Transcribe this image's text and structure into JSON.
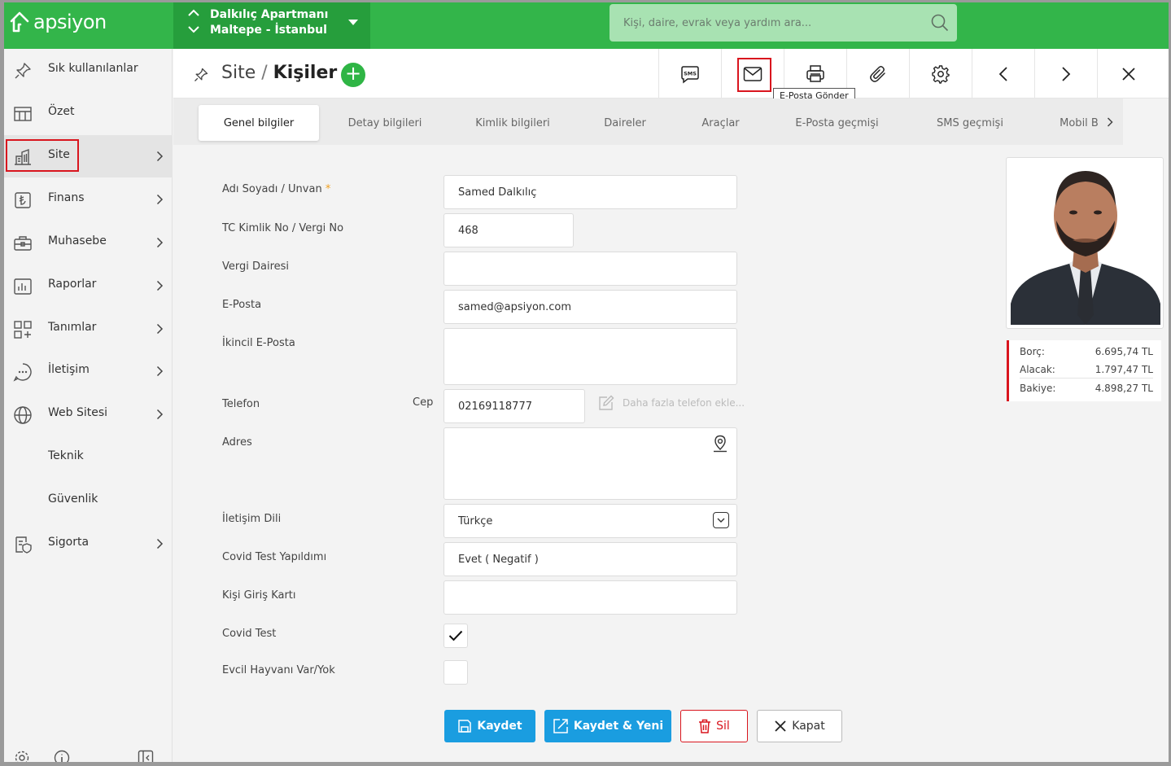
{
  "app": {
    "brand": "apsiyon"
  },
  "site_selector": {
    "name": "Dalkılıç Apartmanı",
    "location": "Maltepe - İstanbul"
  },
  "search": {
    "placeholder": "Kişi, daire, evrak veya yardım ara..."
  },
  "sidebar": {
    "items": [
      {
        "label": "Sık kullanılanlar",
        "icon": "pin-icon"
      },
      {
        "label": "Özet",
        "icon": "table-icon"
      },
      {
        "label": "Site",
        "icon": "building-icon"
      },
      {
        "label": "Finans",
        "icon": "lira-icon"
      },
      {
        "label": "Muhasebe",
        "icon": "briefcase-icon"
      },
      {
        "label": "Raporlar",
        "icon": "report-icon"
      },
      {
        "label": "Tanımlar",
        "icon": "grid-plus-icon"
      },
      {
        "label": "İletişim",
        "icon": "chat-icon"
      },
      {
        "label": "Web Sitesi",
        "icon": "globe-icon"
      },
      {
        "label": "Teknik",
        "icon": ""
      },
      {
        "label": "Güvenlik",
        "icon": ""
      },
      {
        "label": "Sigorta",
        "icon": "shield-doc-icon"
      }
    ]
  },
  "header": {
    "section": "Site",
    "separator": "/",
    "page": "Kişiler"
  },
  "toolbar": {
    "tooltip": "E-Posta Gönder",
    "sms_label": "SMS"
  },
  "tabs": [
    "Genel bilgiler",
    "Detay bilgileri",
    "Kimlik bilgileri",
    "Daireler",
    "Araçlar",
    "E-Posta geçmişi",
    "SMS geçmişi",
    "Mobil B"
  ],
  "form": {
    "name_label": "Adı Soyadı / Unvan",
    "required_mark": "*",
    "name_value": "Samed Dalkılıç",
    "tc_label": "TC Kimlik No / Vergi No",
    "tc_value": "468",
    "tax_office_label": "Vergi Dairesi",
    "tax_office_value": "",
    "email_label": "E-Posta",
    "email_value": "samed@apsiyon.com",
    "email2_label": "İkincil E-Posta",
    "email2_value": "",
    "phone_label": "Telefon",
    "phone_type": "Cep",
    "phone_value": "02169118777",
    "more_phone": "Daha fazla telefon ekle...",
    "address_label": "Adres",
    "address_value": "",
    "lang_label": "İletişim Dili",
    "lang_value": "Türkçe",
    "covid_label": "Covid Test Yapıldımı",
    "covid_value": "Evet ( Negatif )",
    "card_label": "Kişi Giriş Kartı",
    "card_value": "",
    "covid_test_label": "Covid Test",
    "covid_test_checked": true,
    "pet_label": "Evcil Hayvanı Var/Yok",
    "pet_checked": false
  },
  "buttons": {
    "save": "Kaydet",
    "save_new": "Kaydet & Yeni",
    "delete": "Sil",
    "close": "Kapat"
  },
  "balance": {
    "debt_label": "Borç:",
    "debt_value": "6.695,74 TL",
    "credit_label": "Alacak:",
    "credit_value": "1.797,47 TL",
    "balance_label": "Bakiye:",
    "balance_value": "4.898,27 TL"
  },
  "colors": {
    "brand_green": "#33b54a",
    "accent_blue": "#1a9de0",
    "danger_red": "#d9151e"
  }
}
